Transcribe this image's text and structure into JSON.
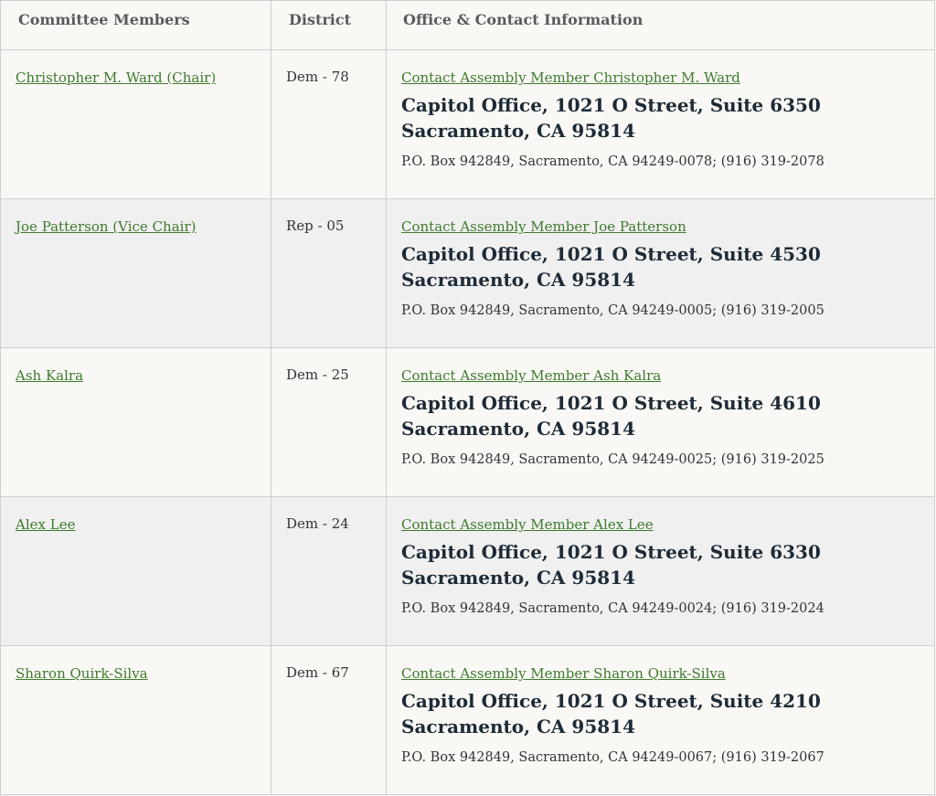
{
  "headers": {
    "members": "Committee Members",
    "district": "District",
    "office": "Office & Contact Information"
  },
  "rows": [
    {
      "name": "Christopher M. Ward (Chair)",
      "district": "Dem - 78",
      "contact": "Contact Assembly Member Christopher M. Ward",
      "office_line1": "Capitol Office, 1021 O Street, Suite 6350",
      "office_line2": "Sacramento, CA 95814",
      "pobox": "P.O. Box 942849, Sacramento, CA 94249-0078; (916) 319-2078"
    },
    {
      "name": "Joe Patterson (Vice Chair)",
      "district": "Rep - 05",
      "contact": "Contact Assembly Member Joe Patterson",
      "office_line1": "Capitol Office, 1021 O Street, Suite 4530",
      "office_line2": "Sacramento, CA 95814",
      "pobox": "P.O. Box 942849, Sacramento, CA 94249-0005; (916) 319-2005"
    },
    {
      "name": "Ash Kalra",
      "district": "Dem - 25",
      "contact": "Contact Assembly Member Ash Kalra",
      "office_line1": "Capitol Office, 1021 O Street, Suite 4610",
      "office_line2": "Sacramento, CA 95814",
      "pobox": "P.O. Box 942849, Sacramento, CA 94249-0025; (916) 319-2025"
    },
    {
      "name": "Alex Lee",
      "district": "Dem - 24",
      "contact": "Contact Assembly Member Alex Lee",
      "office_line1": "Capitol Office, 1021 O Street, Suite 6330",
      "office_line2": "Sacramento, CA 95814",
      "pobox": "P.O. Box 942849, Sacramento, CA 94249-0024; (916) 319-2024"
    },
    {
      "name": "Sharon Quirk-Silva",
      "district": "Dem - 67",
      "contact": "Contact Assembly Member Sharon Quirk-Silva",
      "office_line1": "Capitol Office, 1021 O Street, Suite 4210",
      "office_line2": "Sacramento, CA 95814",
      "pobox": "P.O. Box 942849, Sacramento, CA 94249-0067; (916) 319-2067"
    }
  ],
  "colors": {
    "link": "#3e7a2c",
    "address": "#1d2b38",
    "row_alt": "#f0f0f0",
    "background": "#f9f8f5"
  }
}
